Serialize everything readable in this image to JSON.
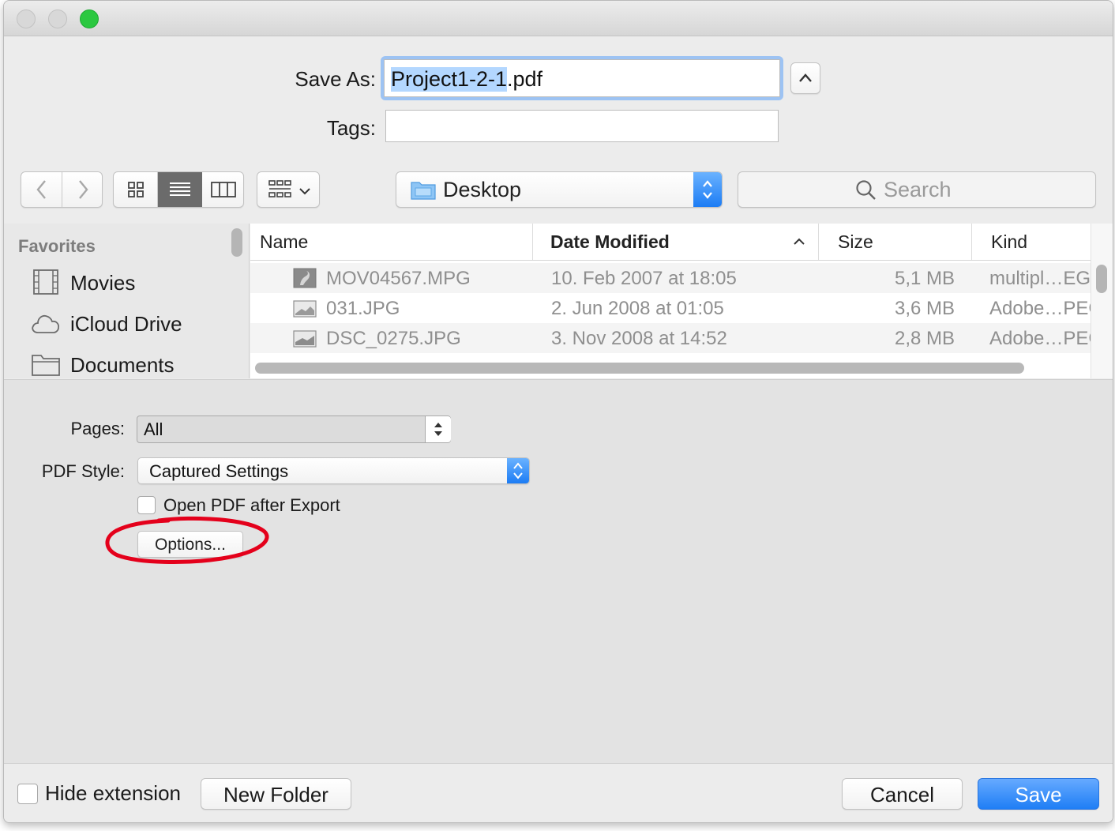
{
  "dialog": {
    "save_as_label": "Save As:",
    "filename_selected": "Project1-2-1",
    "filename_ext": ".pdf",
    "tags_label": "Tags:",
    "tags_value": ""
  },
  "toolbar": {
    "location": "Desktop",
    "search_placeholder": "Search"
  },
  "sidebar": {
    "section": "Favorites",
    "items": [
      {
        "label": "Movies",
        "icon": "film-icon"
      },
      {
        "label": "iCloud Drive",
        "icon": "cloud-icon"
      },
      {
        "label": "Documents",
        "icon": "folder-icon"
      }
    ]
  },
  "file_list": {
    "columns": [
      "Name",
      "Date Modified",
      "Size",
      "Kind"
    ],
    "rows": [
      {
        "name": "MOV04567.MPG",
        "date": "10. Feb 2007 at 18:05",
        "size": "5,1 MB",
        "kind": "multipl…EG-"
      },
      {
        "name": "031.JPG",
        "date": "2. Jun 2008 at 01:05",
        "size": "3,6 MB",
        "kind": "Adobe…PEG"
      },
      {
        "name": "DSC_0275.JPG",
        "date": "3. Nov 2008 at 14:52",
        "size": "2,8 MB",
        "kind": "Adobe…PEG"
      }
    ]
  },
  "export": {
    "pages_label": "Pages:",
    "pages_value": "All",
    "pdf_style_label": "PDF Style:",
    "pdf_style_value": "Captured Settings",
    "open_after_label": "Open PDF after Export",
    "options_label": "Options..."
  },
  "footer": {
    "hide_extension_label": "Hide extension",
    "new_folder_label": "New Folder",
    "cancel_label": "Cancel",
    "save_label": "Save"
  },
  "colors": {
    "accent": "#1f7ef5",
    "selection": "#b3d7ff",
    "annotation": "#e4001b"
  }
}
